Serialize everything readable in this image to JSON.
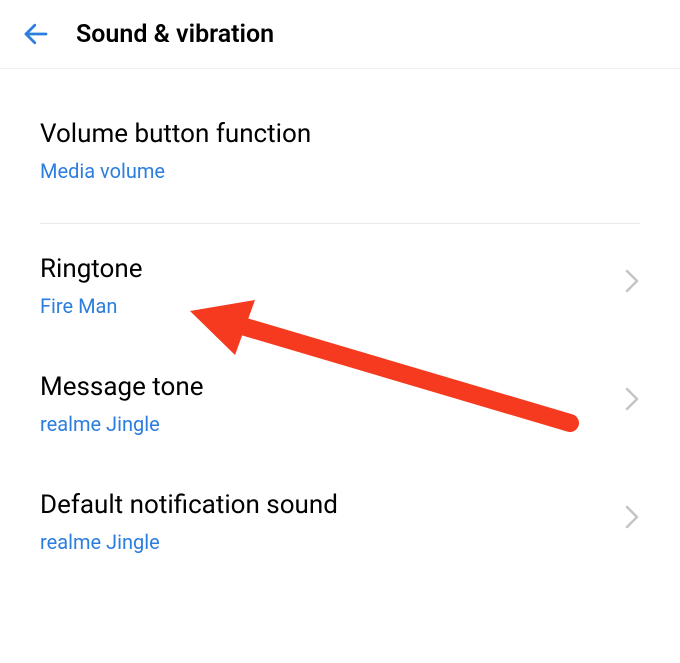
{
  "header": {
    "title": "Sound & vibration"
  },
  "settings": {
    "volume_button": {
      "label": "Volume button function",
      "value": "Media volume"
    },
    "ringtone": {
      "label": "Ringtone",
      "value": "Fire Man"
    },
    "message_tone": {
      "label": "Message tone",
      "value": "realme Jingle"
    },
    "default_notification": {
      "label": "Default notification sound",
      "value": "realme Jingle"
    }
  },
  "annotation": {
    "arrow_color": "#f53a1f"
  }
}
